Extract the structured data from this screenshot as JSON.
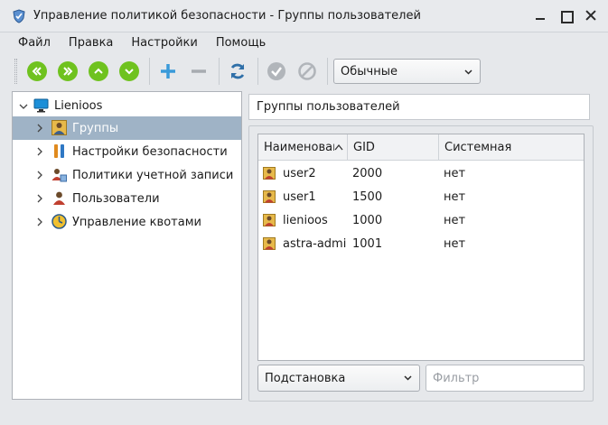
{
  "window": {
    "title": "Управление политикой безопасности - Группы пользователей"
  },
  "menu": [
    "Файл",
    "Правка",
    "Настройки",
    "Помощь"
  ],
  "toolbar": {
    "icons": [
      "double-left-icon",
      "double-right-icon",
      "up-icon",
      "down-icon",
      "add-icon",
      "remove-icon",
      "refresh-icon",
      "apply-icon",
      "cancel-icon"
    ],
    "mode_select": "Обычные"
  },
  "tree": {
    "root": "Lienioos",
    "items": [
      {
        "label": "Группы",
        "selected": true
      },
      {
        "label": "Настройки безопасности",
        "selected": false
      },
      {
        "label": "Политики учетной записи",
        "selected": false
      },
      {
        "label": "Пользователи",
        "selected": false
      },
      {
        "label": "Управление квотами",
        "selected": false
      }
    ]
  },
  "panel": {
    "heading": "Группы пользователей"
  },
  "table": {
    "columns": [
      "Наименование",
      "GID",
      "Системная"
    ],
    "rows": [
      {
        "name": "user2",
        "gid": "2000",
        "system": "нет"
      },
      {
        "name": "user1",
        "gid": "1500",
        "system": "нет"
      },
      {
        "name": "lienioos",
        "gid": "1000",
        "system": "нет"
      },
      {
        "name": "astra-admin",
        "gid": "1001",
        "system": "нет"
      }
    ]
  },
  "filter": {
    "mode": "Подстановка",
    "placeholder": "Фильтр"
  },
  "colors": {
    "accent_green": "#6fc21f",
    "add_blue": "#3a9ad9",
    "selection": "#9fb3c6"
  }
}
